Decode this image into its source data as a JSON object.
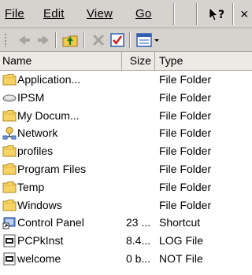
{
  "menu": {
    "file": "File",
    "edit": "Edit",
    "view": "View",
    "go": "Go",
    "help_icon": "whats-this-help-icon",
    "close": "×"
  },
  "toolbar": {
    "buttons": [
      "back-icon",
      "forward-icon",
      "up-folder-icon",
      "delete-icon",
      "properties-icon",
      "views-menu-icon"
    ]
  },
  "columns": {
    "name": "Name",
    "size": "Size",
    "type": "Type"
  },
  "files": [
    {
      "name": "Application...",
      "size": "",
      "type": "File Folder",
      "icon": "folder-icon"
    },
    {
      "name": "IPSM",
      "size": "",
      "type": "File Folder",
      "icon": "storage-card-icon"
    },
    {
      "name": "My Docum...",
      "size": "",
      "type": "File Folder",
      "icon": "folder-icon"
    },
    {
      "name": "Network",
      "size": "",
      "type": "File Folder",
      "icon": "network-icon"
    },
    {
      "name": "profiles",
      "size": "",
      "type": "File Folder",
      "icon": "folder-icon"
    },
    {
      "name": "Program Files",
      "size": "",
      "type": "File Folder",
      "icon": "folder-icon"
    },
    {
      "name": "Temp",
      "size": "",
      "type": "File Folder",
      "icon": "folder-icon"
    },
    {
      "name": "Windows",
      "size": "",
      "type": "File Folder",
      "icon": "folder-icon"
    },
    {
      "name": "Control Panel",
      "size": "23 ...",
      "type": "Shortcut",
      "icon": "shortcut-icon"
    },
    {
      "name": "PCPkInst",
      "size": "8.4...",
      "type": "LOG File",
      "icon": "document-icon"
    },
    {
      "name": "welcome",
      "size": "0 b...",
      "type": "NOT File",
      "icon": "document-icon"
    }
  ]
}
